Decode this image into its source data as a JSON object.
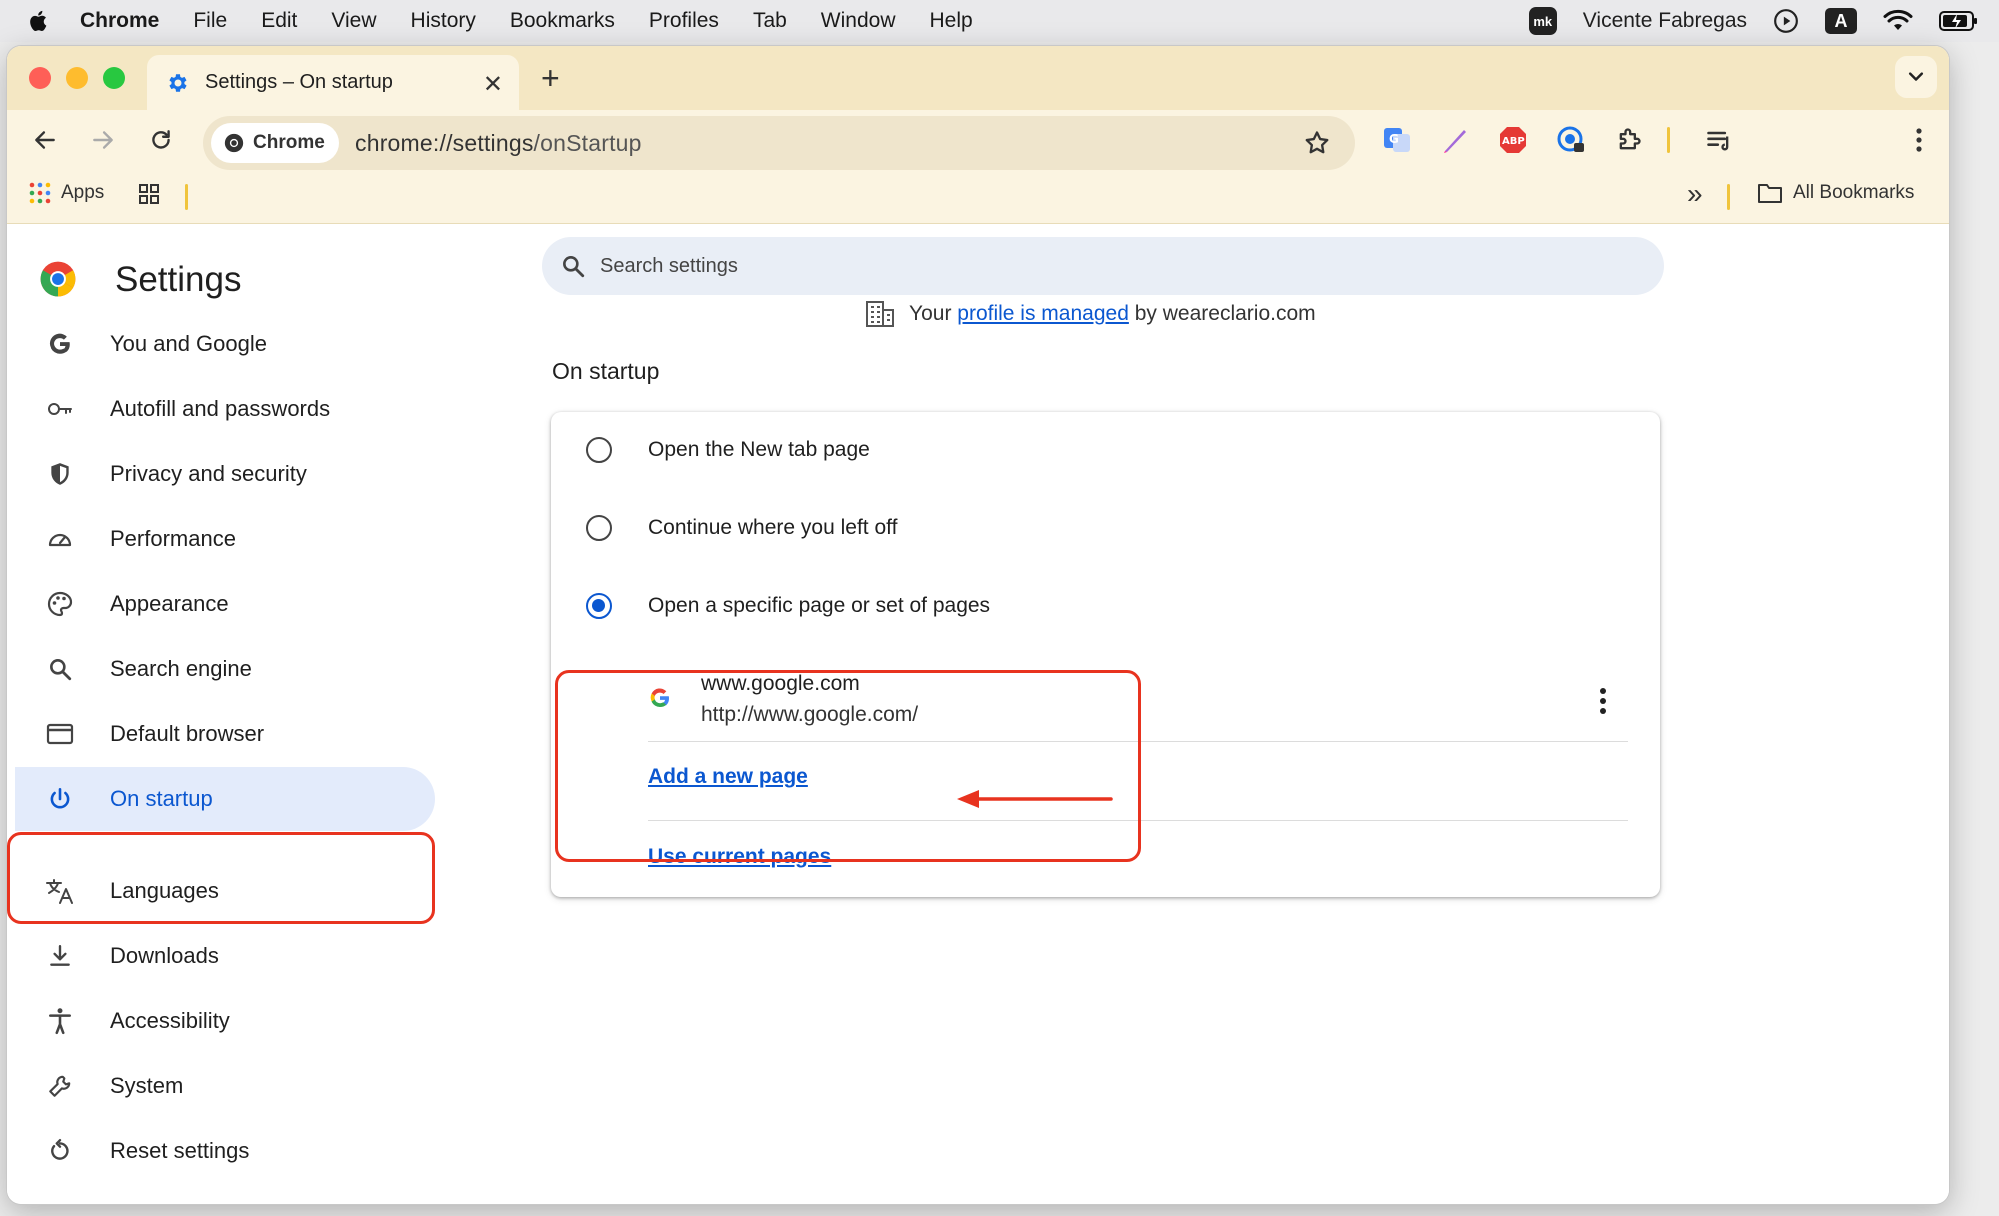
{
  "menubar": {
    "items": [
      "Chrome",
      "File",
      "Edit",
      "View",
      "History",
      "Bookmarks",
      "Profiles",
      "Tab",
      "Window",
      "Help"
    ],
    "user": "Vicente Fabregas",
    "mk_badge": "mk",
    "input_badge": "A"
  },
  "tab": {
    "title": "Settings – On startup",
    "close": "✕",
    "new_tab": "+"
  },
  "omnibox": {
    "chip_label": "Chrome",
    "url_host": "chrome://settings",
    "url_path": "/onStartup"
  },
  "bookmarks": {
    "apps_label": "Apps",
    "overflow": "»",
    "all_bookmarks": "All Bookmarks"
  },
  "extensions": [
    "google-translate-icon",
    "pen-icon",
    "adblock-plus-icon",
    "password-manager-icon",
    "extensions-puzzle-icon",
    "reading-list-icon"
  ],
  "settings": {
    "title": "Settings",
    "search_placeholder": "Search settings",
    "managed_prefix": "Your",
    "managed_link": "profile is managed",
    "managed_suffix": "by weareclario.com",
    "nav": [
      {
        "label": "You and Google",
        "icon": "google-g-icon"
      },
      {
        "label": "Autofill and passwords",
        "icon": "key-icon"
      },
      {
        "label": "Privacy and security",
        "icon": "shield-icon"
      },
      {
        "label": "Performance",
        "icon": "speedometer-icon"
      },
      {
        "label": "Appearance",
        "icon": "palette-icon"
      },
      {
        "label": "Search engine",
        "icon": "search-icon"
      },
      {
        "label": "Default browser",
        "icon": "browser-window-icon"
      },
      {
        "label": "On startup",
        "icon": "power-icon"
      },
      {
        "label": "Languages",
        "icon": "translate-icon"
      },
      {
        "label": "Downloads",
        "icon": "download-icon"
      },
      {
        "label": "Accessibility",
        "icon": "accessibility-icon"
      },
      {
        "label": "System",
        "icon": "wrench-icon"
      },
      {
        "label": "Reset settings",
        "icon": "reset-icon"
      }
    ],
    "active_nav": "On startup"
  },
  "startup": {
    "section_title": "On startup",
    "options": [
      {
        "label": "Open the New tab page",
        "selected": false
      },
      {
        "label": "Continue where you left off",
        "selected": false
      },
      {
        "label": "Open a specific page or set of pages",
        "selected": true
      }
    ],
    "pages": [
      {
        "title": "www.google.com",
        "url": "http://www.google.com/"
      }
    ],
    "add_page": "Add a new page",
    "use_current": "Use current pages"
  },
  "colors": {
    "accent": "#0b57d0",
    "annotation": "#e8331f",
    "tabstrip": "#f4e7c3"
  }
}
